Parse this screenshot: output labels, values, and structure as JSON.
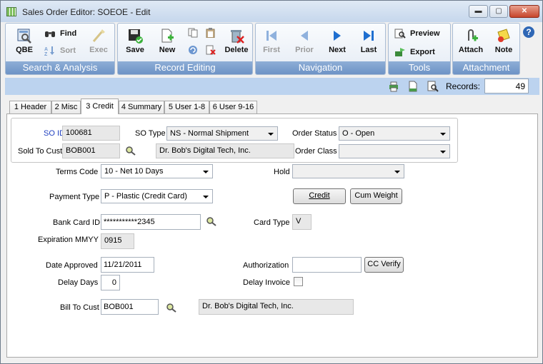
{
  "window": {
    "title": "Sales Order Editor: SOEOE - Edit",
    "min_label": "▬",
    "max_label": "▢",
    "close_label": "✕"
  },
  "ribbon": {
    "search": {
      "group_label": "Search & Analysis",
      "qbe": "QBE",
      "find": "Find",
      "sort": "Sort",
      "exec": "Exec"
    },
    "record": {
      "group_label": "Record Editing",
      "save": "Save",
      "new": "New",
      "delete": "Delete"
    },
    "navigation": {
      "group_label": "Navigation",
      "first": "First",
      "prior": "Prior",
      "next": "Next",
      "last": "Last"
    },
    "tools": {
      "group_label": "Tools",
      "preview": "Preview",
      "export": "Export"
    },
    "attachment": {
      "group_label": "Attachment",
      "attach": "Attach",
      "note": "Note"
    },
    "help": "?"
  },
  "toolbar": {
    "records_label": "Records:",
    "records_value": "49"
  },
  "tabs": [
    {
      "label": "1 Header"
    },
    {
      "label": "2 Misc"
    },
    {
      "label": "3 Credit"
    },
    {
      "label": "4 Summary"
    },
    {
      "label": "5 User 1-8"
    },
    {
      "label": "6 User 9-16"
    }
  ],
  "header": {
    "so_id_label": "SO ID",
    "so_id_value": "100681",
    "so_type_label": "SO Type",
    "so_type_value": "NS - Normal Shipment",
    "order_status_label": "Order Status",
    "order_status_value": "O - Open",
    "sold_to_label": "Sold To Cust",
    "sold_to_value": "BOB001",
    "sold_to_name": "Dr. Bob's Digital Tech, Inc.",
    "order_class_label": "Order Class",
    "order_class_value": ""
  },
  "form": {
    "terms_label": "Terms Code",
    "terms_value": "10 - Net 10 Days",
    "hold_label": "Hold",
    "hold_value": "",
    "payment_label": "Payment Type",
    "payment_value": "P - Plastic (Credit Card)",
    "credit_button": "Credit",
    "cum_weight_button": "Cum Weight",
    "bank_card_label": "Bank Card ID",
    "bank_card_value": "***********2345",
    "card_type_label": "Card Type",
    "card_type_value": "V",
    "expiration_label": "Expiration MMYY",
    "expiration_value": "0915",
    "date_approved_label": "Date Approved",
    "date_approved_value": "11/21/2011",
    "authorization_label": "Authorization",
    "authorization_value": "",
    "cc_verify_button": "CC Verify",
    "delay_days_label": "Delay Days",
    "delay_days_value": "0",
    "delay_invoice_label": "Delay Invoice",
    "bill_to_label": "Bill To Cust",
    "bill_to_value": "BOB001",
    "bill_to_name": "Dr. Bob's Digital Tech, Inc."
  }
}
